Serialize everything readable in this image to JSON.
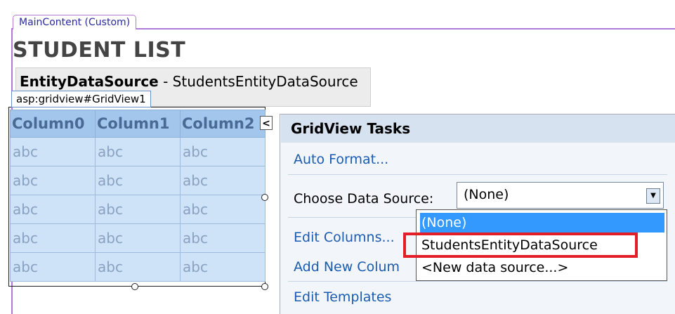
{
  "placeholder": {
    "tab_label": "MainContent (Custom)"
  },
  "page": {
    "title": "STUDENT LIST"
  },
  "datasource": {
    "type_label": "EntityDataSource",
    "separator": " - ",
    "name": "StudentsEntityDataSource"
  },
  "gridview": {
    "tag_label": "asp:gridview#GridView1",
    "columns": [
      "Column0",
      "Column1",
      "Column2"
    ],
    "rows": [
      [
        "abc",
        "abc",
        "abc"
      ],
      [
        "abc",
        "abc",
        "abc"
      ],
      [
        "abc",
        "abc",
        "abc"
      ],
      [
        "abc",
        "abc",
        "abc"
      ],
      [
        "abc",
        "abc",
        "abc"
      ]
    ],
    "colors": {
      "header_bg": "#a3c6ec",
      "cell_bg": "#cfe3f8"
    }
  },
  "smart_tag": {
    "collapse_icon": "chevron-left-icon",
    "glyph": "<"
  },
  "tasks": {
    "title": "GridView Tasks",
    "auto_format": "Auto Format...",
    "choose_label": "Choose Data Source:",
    "choose_value": "(None)",
    "edit_columns": "Edit Columns...",
    "add_column": "Add New Colum",
    "edit_templates": "Edit Templates"
  },
  "dropdown": {
    "options": [
      "(None)",
      "StudentsEntityDataSource",
      "<New data source...>"
    ],
    "selected": "(None)",
    "highlighted_color": "#e41e26"
  }
}
